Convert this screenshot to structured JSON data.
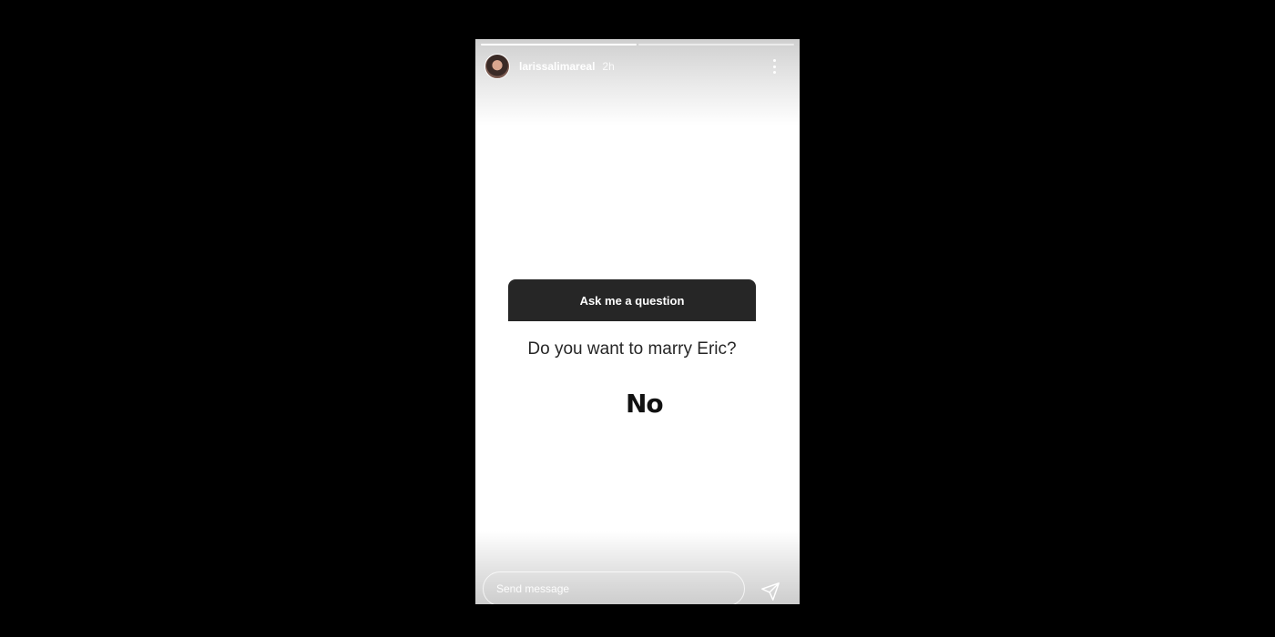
{
  "story": {
    "username": "larissalimareal",
    "timestamp": "2h",
    "progress": {
      "segments": 2,
      "current": 1
    }
  },
  "question_sticker": {
    "prompt": "Ask me a question",
    "question": "Do you want to marry Eric?",
    "answer": "No"
  },
  "reply": {
    "placeholder": "Send message"
  },
  "icons": {
    "more": "more-vertical-icon",
    "send": "send-icon"
  },
  "colors": {
    "background": "#000000",
    "sticker_header": "#262626",
    "story_bg": "#ffffff"
  }
}
